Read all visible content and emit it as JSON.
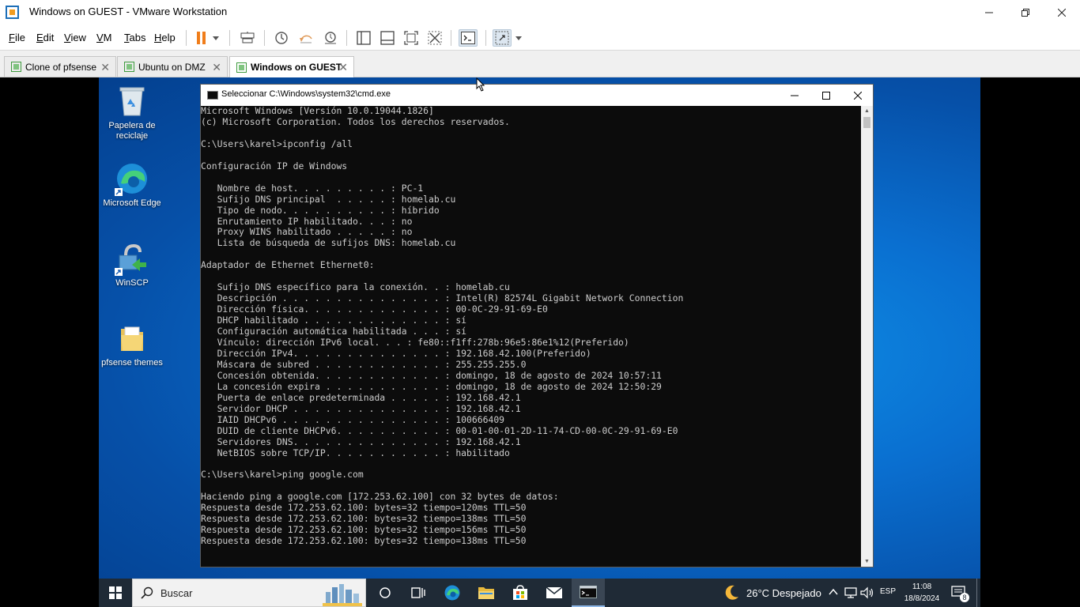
{
  "window": {
    "title": "Windows on GUEST - VMware Workstation"
  },
  "menu": {
    "items": [
      {
        "label": "File",
        "u": "F",
        "rest": "ile"
      },
      {
        "label": "Edit",
        "u": "E",
        "rest": "dit"
      },
      {
        "label": "View",
        "u": "V",
        "rest": "iew"
      },
      {
        "label": "VM",
        "u": "V",
        "rest": "M"
      },
      {
        "label": "Tabs",
        "u": "T",
        "rest": "abs"
      },
      {
        "label": "Help",
        "u": "H",
        "rest": "elp"
      }
    ]
  },
  "tabs": [
    {
      "label": "Clone of pfsense",
      "active": false
    },
    {
      "label": "Ubuntu on DMZ",
      "active": false
    },
    {
      "label": "Windows on GUEST",
      "active": true
    }
  ],
  "desktop_icons": [
    {
      "label_line1": "Papelera de",
      "label_line2": "reciclaje",
      "icon": "recycle-bin-icon"
    },
    {
      "label_line1": "Microsoft Edge",
      "label_line2": "",
      "icon": "edge-icon"
    },
    {
      "label_line1": "WinSCP",
      "label_line2": "",
      "icon": "winscp-icon"
    },
    {
      "label_line1": "pfsense themes",
      "label_line2": "",
      "icon": "folder-icon"
    }
  ],
  "cmd": {
    "title": "Seleccionar C:\\Windows\\system32\\cmd.exe",
    "lines": [
      "Microsoft Windows [Versión 10.0.19044.1826]",
      "(c) Microsoft Corporation. Todos los derechos reservados.",
      "",
      "C:\\Users\\karel>ipconfig /all",
      "",
      "Configuración IP de Windows",
      "",
      "   Nombre de host. . . . . . . . . : PC-1",
      "   Sufijo DNS principal  . . . . . : homelab.cu",
      "   Tipo de nodo. . . . . . . . . . : híbrido",
      "   Enrutamiento IP habilitado. . . : no",
      "   Proxy WINS habilitado . . . . . : no",
      "   Lista de búsqueda de sufijos DNS: homelab.cu",
      "",
      "Adaptador de Ethernet Ethernet0:",
      "",
      "   Sufijo DNS específico para la conexión. . : homelab.cu",
      "   Descripción . . . . . . . . . . . . . . . : Intel(R) 82574L Gigabit Network Connection",
      "   Dirección física. . . . . . . . . . . . . : 00-0C-29-91-69-E0",
      "   DHCP habilitado . . . . . . . . . . . . . : sí",
      "   Configuración automática habilitada . . . : sí",
      "   Vínculo: dirección IPv6 local. . . : fe80::f1ff:278b:96e5:86e1%12(Preferido)",
      "   Dirección IPv4. . . . . . . . . . . . . . : 192.168.42.100(Preferido)",
      "   Máscara de subred . . . . . . . . . . . . : 255.255.255.0",
      "   Concesión obtenida. . . . . . . . . . . . : domingo, 18 de agosto de 2024 10:57:11",
      "   La concesión expira . . . . . . . . . . . : domingo, 18 de agosto de 2024 12:50:29",
      "   Puerta de enlace predeterminada . . . . . : 192.168.42.1",
      "   Servidor DHCP . . . . . . . . . . . . . . : 192.168.42.1",
      "   IAID DHCPv6 . . . . . . . . . . . . . . . : 100666409",
      "   DUID de cliente DHCPv6. . . . . . . . . . : 00-01-00-01-2D-11-74-CD-00-0C-29-91-69-E0",
      "   Servidores DNS. . . . . . . . . . . . . . : 192.168.42.1",
      "   NetBIOS sobre TCP/IP. . . . . . . . . . . : habilitado",
      "",
      "C:\\Users\\karel>ping google.com",
      "",
      "Haciendo ping a google.com [172.253.62.100] con 32 bytes de datos:",
      "Respuesta desde 172.253.62.100: bytes=32 tiempo=120ms TTL=50",
      "Respuesta desde 172.253.62.100: bytes=32 tiempo=138ms TTL=50",
      "Respuesta desde 172.253.62.100: bytes=32 tiempo=156ms TTL=50",
      "Respuesta desde 172.253.62.100: bytes=32 tiempo=138ms TTL=50"
    ]
  },
  "taskbar": {
    "search_placeholder": "Buscar",
    "weather": "26°C  Despejado",
    "language": "ESP",
    "time": "11:08",
    "date": "18/8/2024",
    "notifications": "8"
  }
}
